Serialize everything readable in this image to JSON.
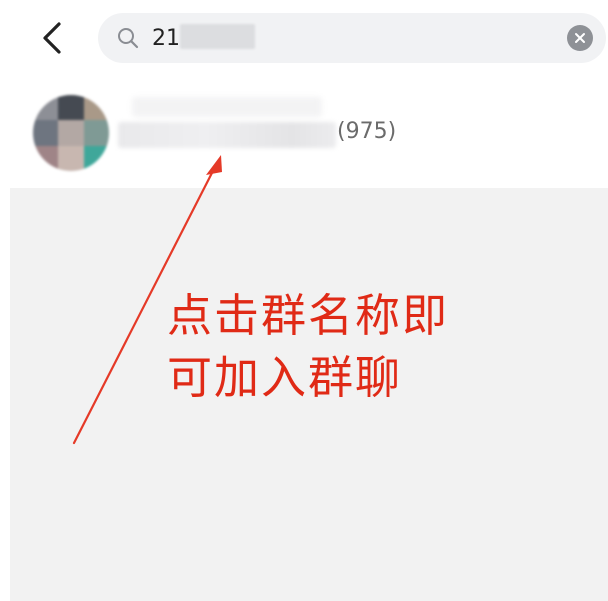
{
  "header": {
    "back_icon": "chevron-left-icon",
    "search": {
      "value": "21",
      "search_icon": "search-icon",
      "clear_icon": "clear-icon"
    }
  },
  "result": {
    "member_count": "(975)"
  },
  "annotation": {
    "line1": "点击群名称即",
    "line2": "可加入群聊",
    "color": "#e02a16"
  },
  "colors": {
    "search_bg": "#f1f2f4",
    "body_bg": "#f2f2f2",
    "annotation_red": "#e02a16"
  }
}
